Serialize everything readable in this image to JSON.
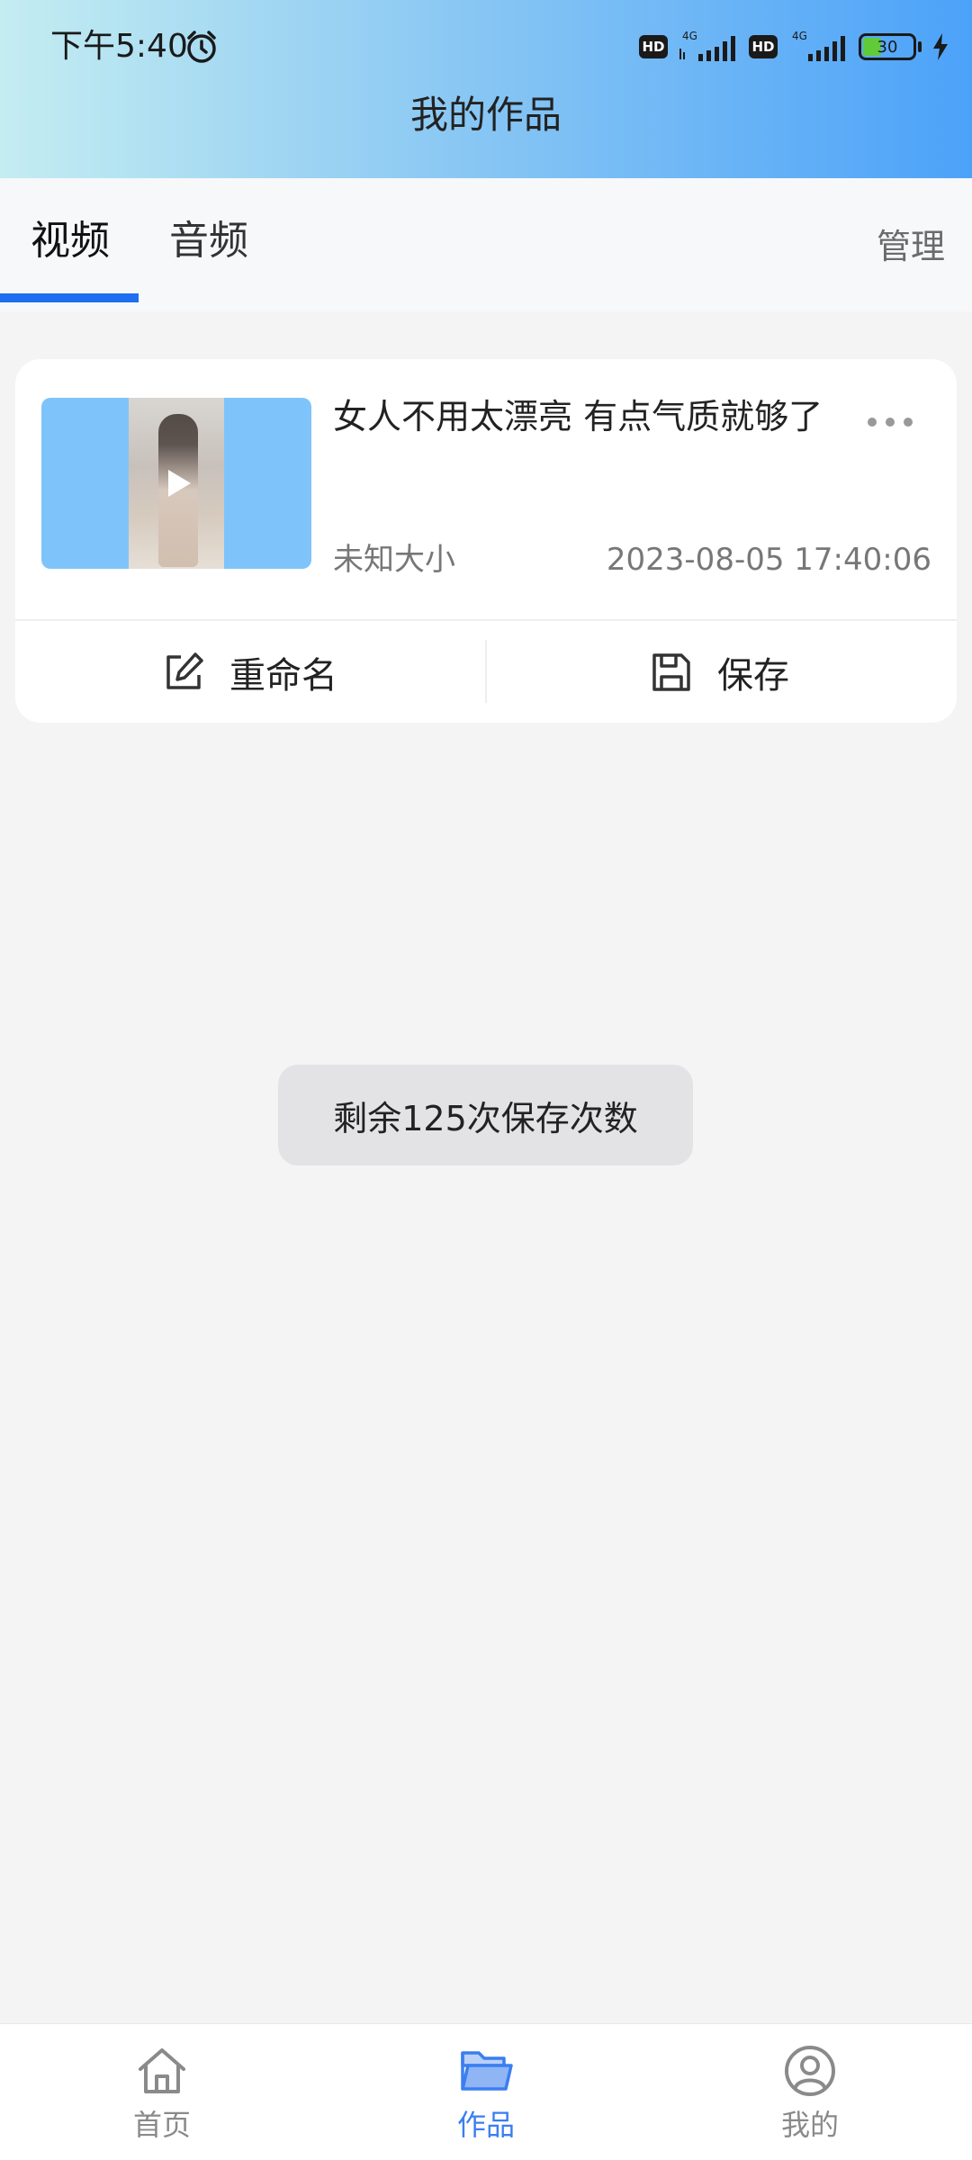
{
  "status_bar": {
    "time": "下午5:40",
    "hd1": "HD",
    "hd2": "HD",
    "net1": "4G",
    "net2": "4G",
    "battery": "30"
  },
  "header": {
    "title": "我的作品"
  },
  "tabs": [
    {
      "label": "视频",
      "active": true
    },
    {
      "label": "音频",
      "active": false
    }
  ],
  "manage_label": "管理",
  "work_item": {
    "title": "女人不用太漂亮 有点气质就够了",
    "size": "未知大小",
    "date": "2023-08-05 17:40:06",
    "rename_label": "重命名",
    "save_label": "保存"
  },
  "toast": "剩余125次保存次数",
  "bottom_nav": [
    {
      "label": "首页",
      "icon": "home-icon",
      "active": false
    },
    {
      "label": "作品",
      "icon": "folder-icon",
      "active": true
    },
    {
      "label": "我的",
      "icon": "user-icon",
      "active": false
    }
  ],
  "colors": {
    "accent": "#1f6ff0",
    "nav_active": "#3b7ef0",
    "header_gradient_start": "#c4edf1",
    "header_gradient_end": "#4ca2f9"
  }
}
